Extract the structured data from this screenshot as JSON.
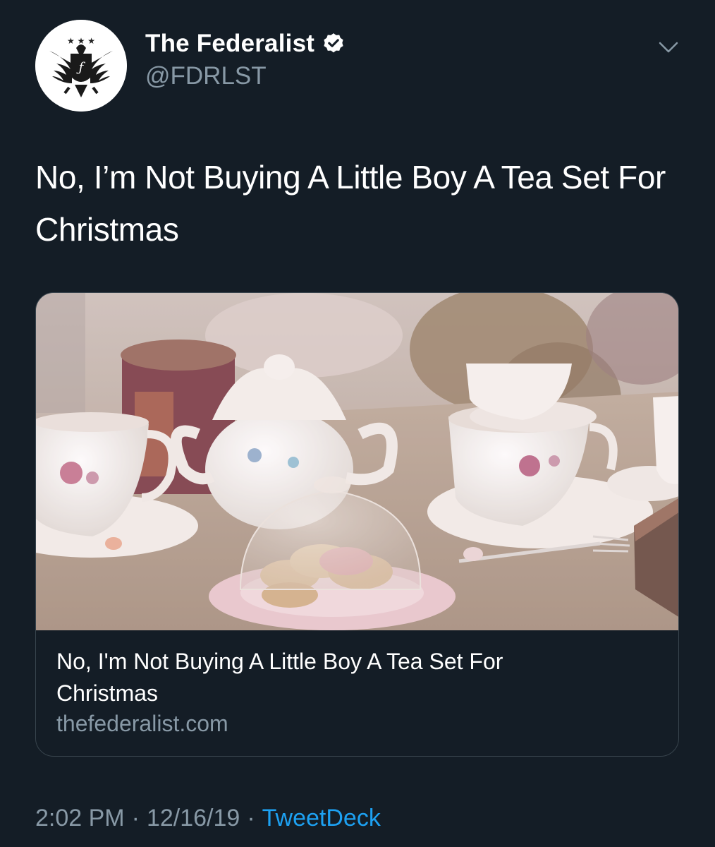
{
  "author": {
    "display_name": "The Federalist",
    "handle": "@FDRLST",
    "verified": true,
    "avatar_icon": "federalist-eagle-logo",
    "verified_icon": "verified-badge-icon"
  },
  "menu_icon": "chevron-down-icon",
  "tweet": {
    "text": "No, I’m Not Buying A Little Boy A Tea Set For Christmas"
  },
  "card": {
    "image_subject": "tea-set-photo",
    "title": "No, I'm Not Buying A Little Boy A Tea Set For Christmas",
    "domain": "thefederalist.com"
  },
  "meta": {
    "time": "2:02 PM",
    "separator": "·",
    "date": "12/16/19",
    "source": "TweetDeck"
  },
  "colors": {
    "background": "#141d26",
    "secondary_text": "#8899a6",
    "link": "#1da1f2",
    "border": "#38444d"
  }
}
